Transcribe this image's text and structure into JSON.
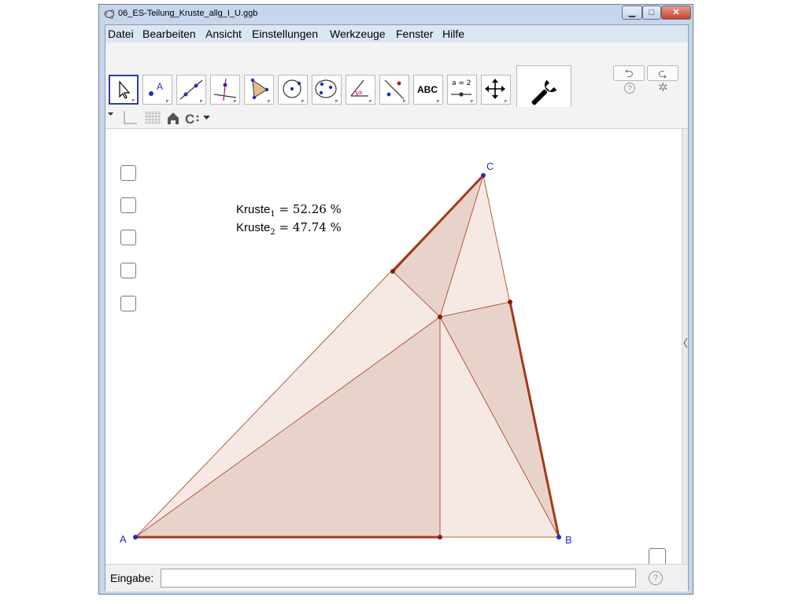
{
  "window": {
    "title": "06_ES-Teilung_Kruste_allg_I_U.ggb"
  },
  "menu": [
    "Datei",
    "Bearbeiten",
    "Ansicht",
    "Einstellungen",
    "Werkzeuge",
    "Fenster",
    "Hilfe"
  ],
  "toolbar": {
    "text_tool_label": "ABC",
    "slider_tool_label": "a = 2"
  },
  "graphics": {
    "kruste1_label": "Kruste",
    "kruste1_sub": "1",
    "kruste1_value": " = 52.26 %",
    "kruste2_label": "Kruste",
    "kruste2_sub": "2",
    "kruste2_value": " = 47.74 %",
    "points": {
      "A": "A",
      "B": "B",
      "C": "C"
    },
    "colors": {
      "fill": "#e8d3cb",
      "edge": "#a33a1c",
      "point": "#1a31c4"
    }
  },
  "input_bar": {
    "label": "Eingabe:",
    "value": ""
  }
}
